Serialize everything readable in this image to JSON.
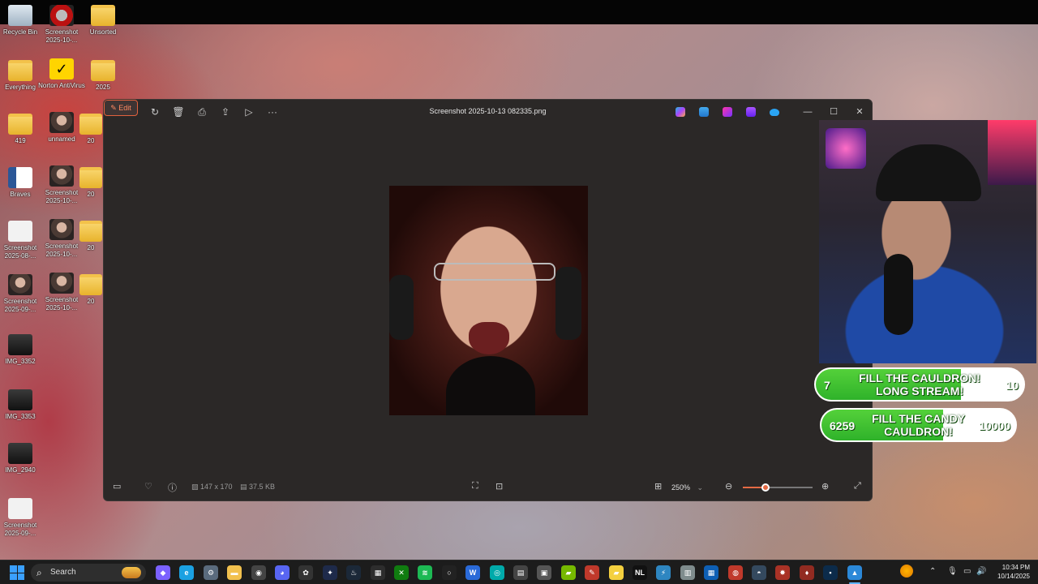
{
  "desktop": {
    "icons": [
      {
        "label": "Recycle Bin",
        "icon": "recycle-bin-icon"
      },
      {
        "label": "Screenshot 2025-10-...",
        "icon": "image-icon"
      },
      {
        "label": "Unsorted",
        "icon": "folder-icon"
      },
      {
        "label": "Everything",
        "icon": "folder-icon"
      },
      {
        "label": "Norton AntiVirus",
        "icon": "norton-icon"
      },
      {
        "label": "2025",
        "icon": "folder-icon"
      },
      {
        "label": "419",
        "icon": "folder-icon"
      },
      {
        "label": "unnamed",
        "icon": "image-icon"
      },
      {
        "label": "20",
        "icon": "folder-icon"
      },
      {
        "label": "Braves",
        "icon": "word-document-icon"
      },
      {
        "label": "Screenshot 2025-10-...",
        "icon": "image-icon"
      },
      {
        "label": "20",
        "icon": "folder-icon"
      },
      {
        "label": "Screenshot 2025-08-...",
        "icon": "image-icon"
      },
      {
        "label": "Screenshot 2025-10-...",
        "icon": "image-icon"
      },
      {
        "label": "20",
        "icon": "folder-icon"
      },
      {
        "label": "Screenshot 2025-09-...",
        "icon": "image-icon"
      },
      {
        "label": "Screenshot 2025-10-...",
        "icon": "image-icon"
      },
      {
        "label": "20",
        "icon": "folder-icon"
      },
      {
        "label": "IMG_3352",
        "icon": "image-icon"
      },
      {
        "label": "IMG_3353",
        "icon": "image-icon"
      },
      {
        "label": "IMG_2940",
        "icon": "image-icon"
      },
      {
        "label": "Screenshot 2025-09-...",
        "icon": "image-icon"
      }
    ]
  },
  "viewer": {
    "edit_label": "Edit",
    "file_title": "Screenshot 2025-10-13 082335.png",
    "toolbar_icons": [
      "rotate-icon",
      "delete-icon",
      "print-icon",
      "share-icon",
      "slideshow-icon",
      "more-icon"
    ],
    "app_icons": [
      "copilot-icon",
      "photos-icon",
      "designer-icon",
      "clipchamp-icon",
      "onedrive-icon"
    ],
    "window_controls": {
      "minimize": "—",
      "maximize": "☐",
      "close": "✕"
    },
    "status": {
      "dimensions": "147 x 170",
      "file_size": "37.5 KB",
      "zoom": "250%",
      "zoom_level": 0.33
    }
  },
  "overlay": {
    "goals": [
      {
        "current": "7",
        "title_line1": "FILL THE CAULDRON!",
        "title_line2": "LONG STREAM!",
        "target": "10",
        "fill_fraction": 0.7
      },
      {
        "current": "6259",
        "title_line1": "FILL THE CANDY",
        "title_line2": "CAULDRON!",
        "target": "10000",
        "fill_fraction": 0.6259
      }
    ]
  },
  "taskbar": {
    "search_placeholder": "Search",
    "clock_time": "10:34 PM",
    "clock_date": "10/14/2025",
    "pinned": [
      {
        "name": "copilot",
        "color": "#7b61ff",
        "glyph": "◆"
      },
      {
        "name": "edge",
        "color": "#1ba1e2",
        "glyph": "e"
      },
      {
        "name": "settings",
        "color": "#5a6b7d",
        "glyph": "⚙"
      },
      {
        "name": "file-explorer",
        "color": "#f2c14e",
        "glyph": "▬"
      },
      {
        "name": "obs",
        "color": "#444",
        "glyph": "◉"
      },
      {
        "name": "discord",
        "color": "#5865f2",
        "glyph": "◕"
      },
      {
        "name": "chatgpt",
        "color": "#333",
        "glyph": "✿"
      },
      {
        "name": "photoshop",
        "color": "#1e2a4a",
        "glyph": "✦"
      },
      {
        "name": "steam",
        "color": "#1b2838",
        "glyph": "♨"
      },
      {
        "name": "app-10",
        "color": "#2d2d2d",
        "glyph": "▦"
      },
      {
        "name": "xbox",
        "color": "#107c10",
        "glyph": "✕"
      },
      {
        "name": "spotify",
        "color": "#1db954",
        "glyph": "≋"
      },
      {
        "name": "app-13",
        "color": "#222",
        "glyph": "○"
      },
      {
        "name": "app-14",
        "color": "#2a6ad8",
        "glyph": "W"
      },
      {
        "name": "app-15",
        "color": "#0aa",
        "glyph": "◎"
      },
      {
        "name": "calculator",
        "color": "#444",
        "glyph": "▤"
      },
      {
        "name": "app-17",
        "color": "#555",
        "glyph": "▣"
      },
      {
        "name": "app-18",
        "color": "#76b900",
        "glyph": "▰"
      },
      {
        "name": "app-19",
        "color": "#c0392b",
        "glyph": "✎"
      },
      {
        "name": "sticky-notes",
        "color": "#f4d03f",
        "glyph": "▰"
      },
      {
        "name": "app-21",
        "color": "#111",
        "glyph": "NL"
      },
      {
        "name": "app-22",
        "color": "#2e86c1",
        "glyph": "⚡"
      },
      {
        "name": "app-23",
        "color": "#7f8c8d",
        "glyph": "▥"
      },
      {
        "name": "store",
        "color": "#0e5fb4",
        "glyph": "▦"
      },
      {
        "name": "app-25",
        "color": "#c0392b",
        "glyph": "◍"
      },
      {
        "name": "app-26",
        "color": "#34495e",
        "glyph": "◓"
      },
      {
        "name": "app-27",
        "color": "#a93226",
        "glyph": "✸"
      },
      {
        "name": "app-28",
        "color": "#922b21",
        "glyph": "♦"
      },
      {
        "name": "terminal",
        "color": "#0c2b4a",
        "glyph": "▪"
      },
      {
        "name": "photos-active",
        "color": "#2b88d8",
        "glyph": "▲"
      }
    ],
    "tray_icons": [
      "weather-icon",
      "chevron-up-icon",
      "microphone-icon",
      "network-icon",
      "volume-icon"
    ]
  },
  "colors": {
    "accent": "#e46a44",
    "goal_green": "#3fc12e",
    "viewer_bg": "#2b2827"
  }
}
